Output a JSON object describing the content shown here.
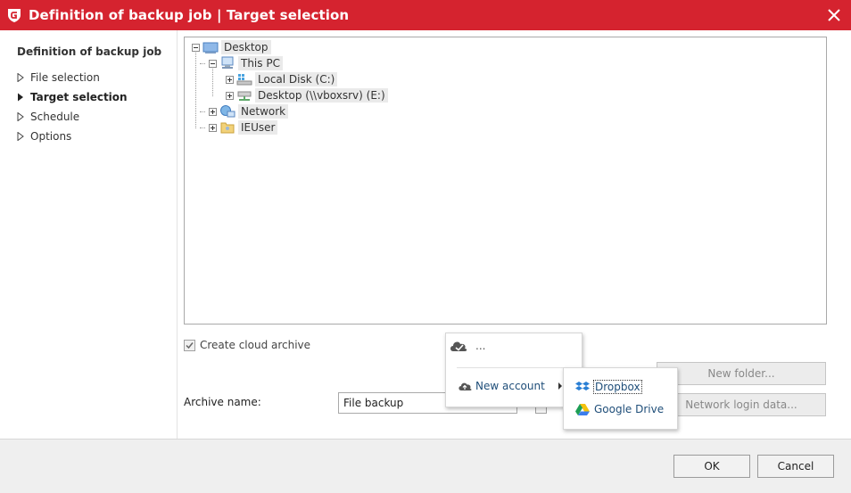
{
  "window": {
    "title": "Definition of backup job | Target selection",
    "accent": "#d5232f"
  },
  "nav": {
    "heading": "Definition of backup job",
    "items": [
      {
        "label": "File selection",
        "active": false
      },
      {
        "label": "Target selection",
        "active": true
      },
      {
        "label": "Schedule",
        "active": false
      },
      {
        "label": "Options",
        "active": false
      }
    ]
  },
  "tree": {
    "nodes": [
      {
        "label": "Desktop",
        "icon": "desktop-icon"
      },
      {
        "label": "This PC",
        "icon": "computer-icon"
      },
      {
        "label": "Local Disk (C:)",
        "icon": "drive-icon"
      },
      {
        "label": "Desktop (\\\\vboxsrv) (E:)",
        "icon": "network-drive-icon"
      },
      {
        "label": "Network",
        "icon": "network-icon"
      },
      {
        "label": "IEUser",
        "icon": "user-folder-icon"
      }
    ]
  },
  "cloud": {
    "checkbox_label": "Create cloud archive",
    "checked": true,
    "selector_text": "...",
    "new_account_label": "New account",
    "providers": [
      "Dropbox",
      "Google Drive"
    ]
  },
  "archive": {
    "label": "Archive name:",
    "value": "File backup"
  },
  "buttons": {
    "new_folder": "New folder...",
    "network_login": "Network login data...",
    "ok": "OK",
    "cancel": "Cancel"
  }
}
